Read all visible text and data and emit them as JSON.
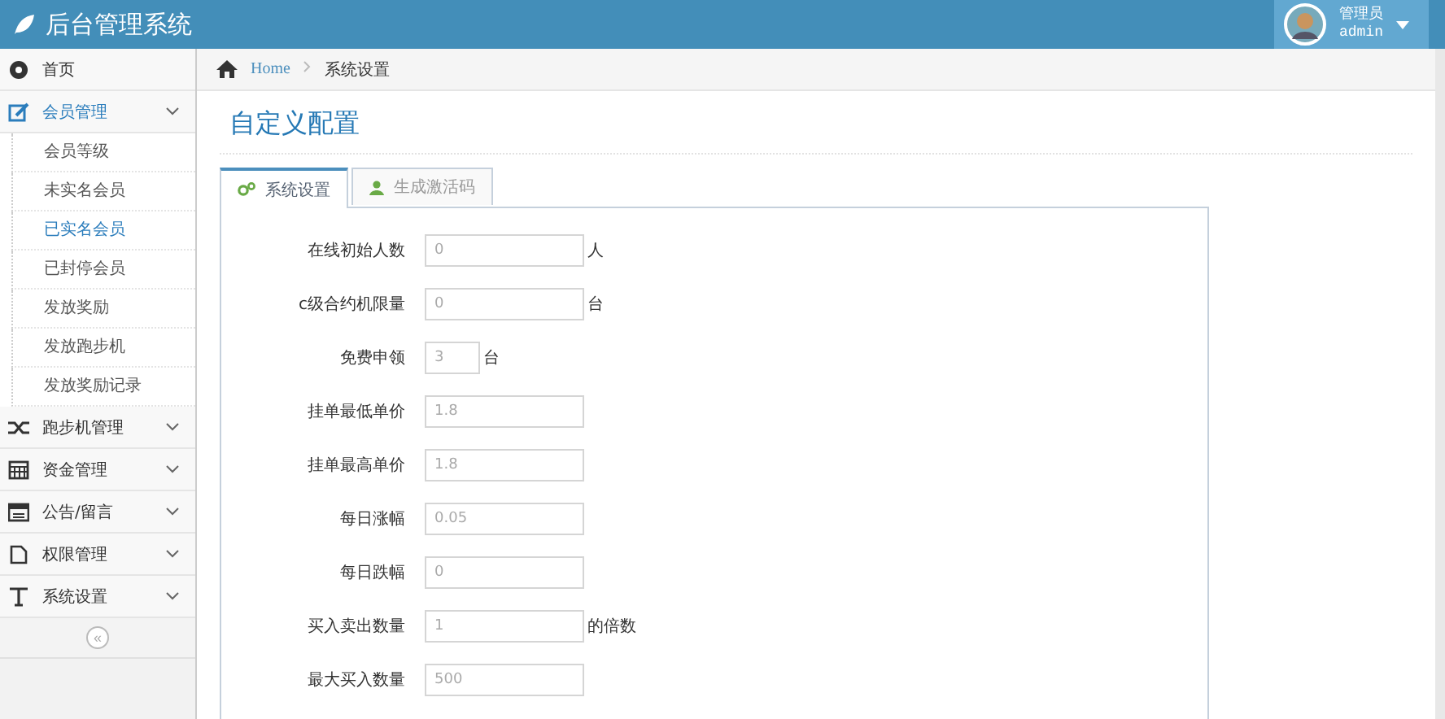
{
  "header": {
    "title": "后台管理系统",
    "user": {
      "role": "管理员",
      "name": "admin"
    }
  },
  "sidebar": {
    "items": [
      {
        "kind": "link",
        "label": "首页",
        "expanded": false
      },
      {
        "kind": "menu",
        "label": "会员管理",
        "expanded": true,
        "children": [
          {
            "label": "会员等级",
            "selected": false
          },
          {
            "label": "未实名会员",
            "selected": false
          },
          {
            "label": "已实名会员",
            "selected": true
          },
          {
            "label": "已封停会员",
            "selected": false
          },
          {
            "label": "发放奖励",
            "selected": false
          },
          {
            "label": "发放跑步机",
            "selected": false
          },
          {
            "label": "发放奖励记录",
            "selected": false
          }
        ]
      },
      {
        "kind": "menu",
        "label": "跑步机管理",
        "expanded": false
      },
      {
        "kind": "menu",
        "label": "资金管理",
        "expanded": false
      },
      {
        "kind": "menu",
        "label": "公告/留言",
        "expanded": false
      },
      {
        "kind": "menu",
        "label": "权限管理",
        "expanded": false
      },
      {
        "kind": "menu",
        "label": "系统设置",
        "expanded": false
      }
    ],
    "collapse": "«"
  },
  "breadcrumb": [
    "Home",
    "系统设置"
  ],
  "page_title": "自定义配置",
  "tabs": [
    {
      "label": "系统设置",
      "selected": true
    },
    {
      "label": "生成激活码",
      "selected": false
    }
  ],
  "form": [
    {
      "kind": "long",
      "label": "在线初始人数",
      "value": "0",
      "suffix": "人"
    },
    {
      "kind": "long",
      "label": "c级合约机限量",
      "value": "0",
      "suffix": "台"
    },
    {
      "kind": "short",
      "label": "免费申领",
      "value": "3",
      "suffix": "台"
    },
    {
      "kind": "long",
      "label": "挂单最低单价",
      "value": "1.8"
    },
    {
      "kind": "long",
      "label": "挂单最高单价",
      "value": "1.8"
    },
    {
      "kind": "long",
      "label": "每日涨幅",
      "value": "0.05"
    },
    {
      "kind": "long",
      "label": "每日跌幅",
      "value": "0"
    },
    {
      "kind": "long",
      "label": "买入卖出数量",
      "value": "1",
      "suffix": "的倍数"
    },
    {
      "kind": "long",
      "label": "最大买入数量",
      "value": "500"
    }
  ]
}
